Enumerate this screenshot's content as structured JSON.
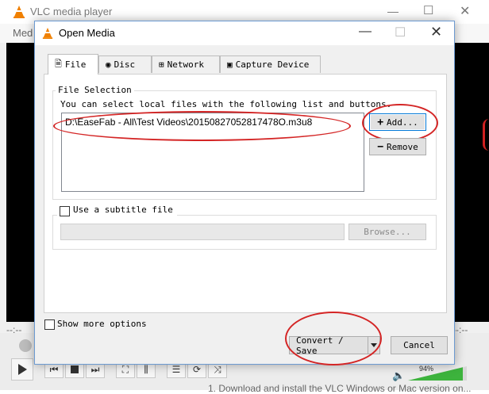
{
  "vlc": {
    "title": "VLC media player",
    "menu_partial": "Med",
    "seek_left": "--:--",
    "seek_right": "--:--",
    "volume": "94%",
    "caption": "1. Download and install the VLC Windows or Mac version on..."
  },
  "dialog": {
    "title": "Open Media",
    "tabs": [
      {
        "label": "File",
        "icon": "file-icon"
      },
      {
        "label": "Disc",
        "icon": "disc-icon"
      },
      {
        "label": "Network",
        "icon": "network-icon"
      },
      {
        "label": "Capture Device",
        "icon": "capture-device-icon"
      }
    ],
    "file_selection": {
      "legend": "File Selection",
      "hint": "You can select local files with the following list and buttons.",
      "files": [
        "D:\\EaseFab - All\\Test Videos\\20150827052817478O.m3u8"
      ],
      "add_label": "Add...",
      "remove_label": "Remove"
    },
    "subtitle": {
      "checkbox_label": "Use a subtitle file",
      "browse_label": "Browse..."
    },
    "show_more_label": "Show more options",
    "convert_save_label": "Convert / Save",
    "cancel_label": "Cancel"
  },
  "colors": {
    "annotation_red": "#d42525",
    "accent_blue": "#0078d7",
    "vlc_orange": "#f08000"
  }
}
